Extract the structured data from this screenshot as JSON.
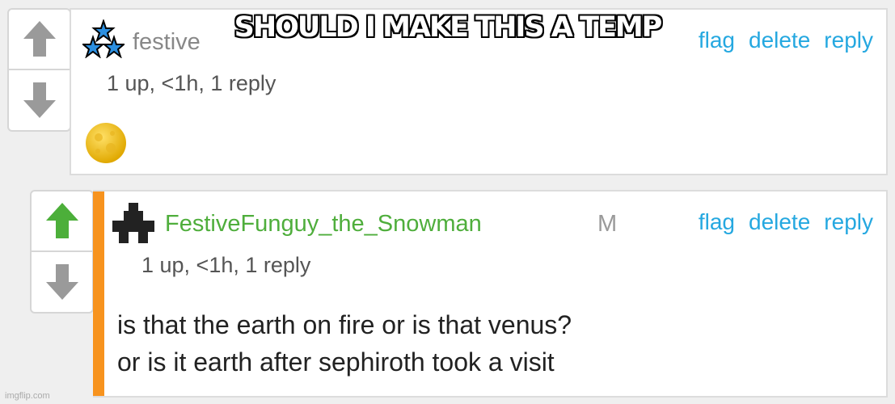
{
  "caption": "SHOULD I MAKE THIS A TEMP",
  "watermark": "imgflip.com",
  "comment1": {
    "username": "festive",
    "actions": {
      "flag": "flag",
      "delete": "delete",
      "reply": "reply"
    },
    "meta": "1 up, <1h, 1 reply",
    "content_icon": "moon-emoji",
    "badge_icon": "three-stars-icon"
  },
  "comment2": {
    "username": "FestiveFunguy_the_Snowman",
    "mod_badge": "M",
    "actions": {
      "flag": "flag",
      "delete": "delete",
      "reply": "reply"
    },
    "meta": "1 up, <1h, 1 reply",
    "body_lines": [
      "is that the earth on fire or is that venus?",
      "or is it earth after sephiroth took a visit"
    ],
    "badge_icon": "black-tree-icon"
  },
  "colors": {
    "upvote_active": "#4caf3a",
    "vote_inactive": "#9a9a9a",
    "link": "#25a8e0",
    "username_green": "#4fae3c",
    "reply_bar": "#f7931e"
  }
}
